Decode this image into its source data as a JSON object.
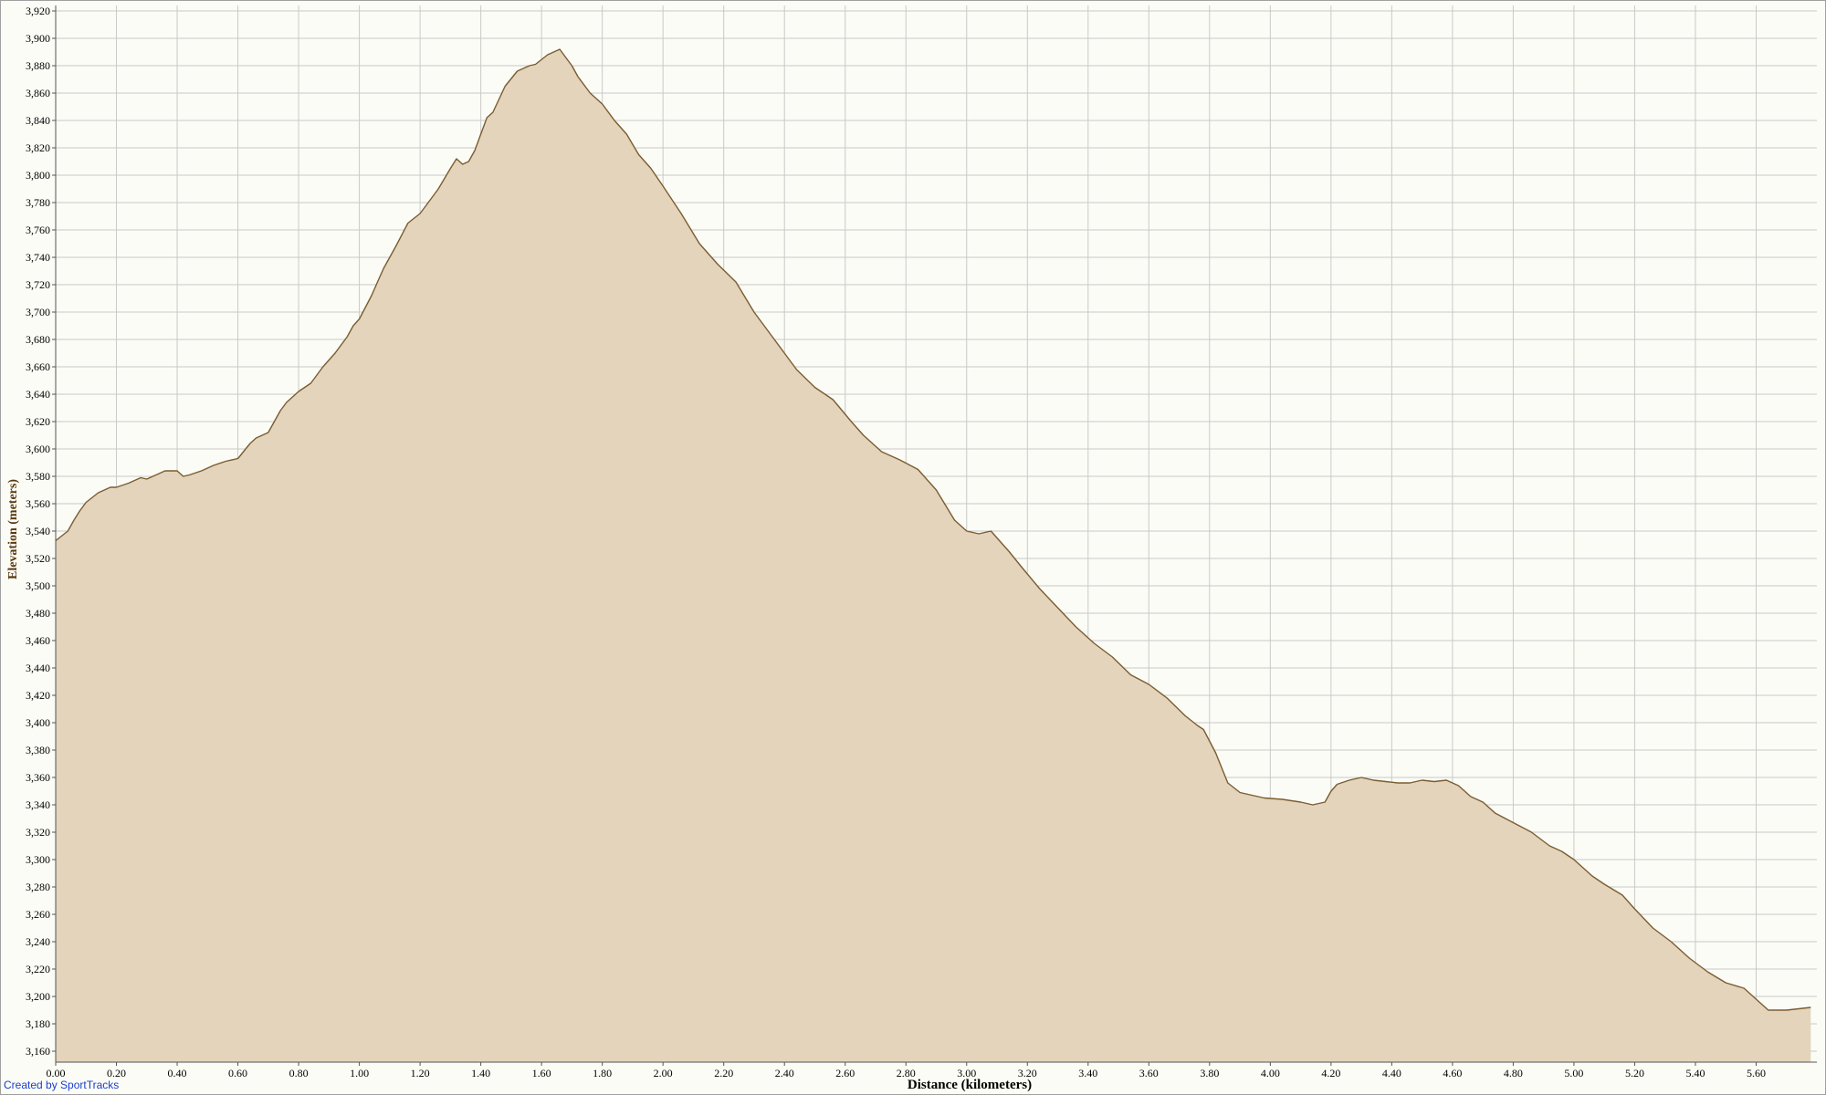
{
  "chart_data": {
    "type": "area",
    "title": "",
    "xlabel": "Distance (kilometers)",
    "ylabel": "Elevation (meters)",
    "xlim": [
      0,
      5.8
    ],
    "ylim": [
      3152,
      3924
    ],
    "x_ticks": [
      "0.00",
      "0.20",
      "0.40",
      "0.60",
      "0.80",
      "1.00",
      "1.20",
      "1.40",
      "1.60",
      "1.80",
      "2.00",
      "2.20",
      "2.40",
      "2.60",
      "2.80",
      "3.00",
      "3.20",
      "3.40",
      "3.60",
      "3.80",
      "4.00",
      "4.20",
      "4.40",
      "4.60",
      "4.80",
      "5.00",
      "5.20",
      "5.40",
      "5.60"
    ],
    "y_ticks": [
      "3,160",
      "3,180",
      "3,200",
      "3,220",
      "3,240",
      "3,260",
      "3,280",
      "3,300",
      "3,320",
      "3,340",
      "3,360",
      "3,380",
      "3,400",
      "3,420",
      "3,440",
      "3,460",
      "3,480",
      "3,500",
      "3,520",
      "3,540",
      "3,560",
      "3,580",
      "3,600",
      "3,620",
      "3,640",
      "3,660",
      "3,680",
      "3,700",
      "3,720",
      "3,740",
      "3,760",
      "3,780",
      "3,800",
      "3,820",
      "3,840",
      "3,860",
      "3,880",
      "3,900",
      "3,920"
    ],
    "grid": true,
    "legend": "none",
    "colors": {
      "fill": "#e3d4bb",
      "line": "#7a5c30",
      "grid": "#c9c9c9",
      "plot_bg": "#fcfcf6",
      "axis": "#555555"
    },
    "series": [
      {
        "x": [
          0.0,
          0.04,
          0.06,
          0.08,
          0.1,
          0.14,
          0.18,
          0.2,
          0.24,
          0.28,
          0.3,
          0.34,
          0.36,
          0.4,
          0.42,
          0.44,
          0.48,
          0.52,
          0.56,
          0.6,
          0.64,
          0.66,
          0.7,
          0.74,
          0.76,
          0.8,
          0.84,
          0.88,
          0.92,
          0.96,
          0.98,
          1.0,
          1.04,
          1.06,
          1.08,
          1.12,
          1.16,
          1.2,
          1.22,
          1.26,
          1.3,
          1.32,
          1.34,
          1.36,
          1.38,
          1.4,
          1.42,
          1.44,
          1.48,
          1.52,
          1.56,
          1.58,
          1.62,
          1.66,
          1.68,
          1.7,
          1.72,
          1.76,
          1.8,
          1.84,
          1.88,
          1.92,
          1.96,
          2.0,
          2.06,
          2.12,
          2.18,
          2.24,
          2.3,
          2.36,
          2.4,
          2.44,
          2.5,
          2.56,
          2.62,
          2.66,
          2.72,
          2.78,
          2.84,
          2.9,
          2.96,
          3.0,
          3.04,
          3.08,
          3.1,
          3.14,
          3.18,
          3.24,
          3.3,
          3.36,
          3.42,
          3.48,
          3.54,
          3.6,
          3.66,
          3.72,
          3.76,
          3.78,
          3.82,
          3.86,
          3.9,
          3.94,
          3.98,
          4.04,
          4.1,
          4.14,
          4.18,
          4.2,
          4.22,
          4.26,
          4.3,
          4.34,
          4.38,
          4.42,
          4.46,
          4.5,
          4.54,
          4.58,
          4.6,
          4.62,
          4.66,
          4.7,
          4.74,
          4.8,
          4.86,
          4.92,
          4.96,
          5.0,
          5.06,
          5.1,
          5.16,
          5.2,
          5.26,
          5.32,
          5.38,
          5.44,
          5.5,
          5.56,
          5.6,
          5.64,
          5.7,
          5.78
        ],
        "y": [
          3533,
          3540,
          3548,
          3555,
          3561,
          3568,
          3572,
          3572,
          3575,
          3579,
          3578,
          3582,
          3584,
          3584,
          3580,
          3581,
          3584,
          3588,
          3591,
          3593,
          3604,
          3608,
          3612,
          3628,
          3634,
          3642,
          3648,
          3660,
          3670,
          3682,
          3690,
          3695,
          3712,
          3722,
          3732,
          3748,
          3765,
          3772,
          3778,
          3790,
          3805,
          3812,
          3808,
          3810,
          3818,
          3830,
          3842,
          3846,
          3865,
          3876,
          3880,
          3881,
          3888,
          3892,
          3886,
          3880,
          3872,
          3860,
          3852,
          3840,
          3830,
          3815,
          3805,
          3792,
          3772,
          3750,
          3735,
          3722,
          3700,
          3682,
          3670,
          3658,
          3645,
          3636,
          3620,
          3610,
          3598,
          3592,
          3585,
          3570,
          3548,
          3540,
          3538,
          3540,
          3535,
          3525,
          3514,
          3498,
          3484,
          3470,
          3458,
          3448,
          3435,
          3428,
          3418,
          3405,
          3398,
          3395,
          3378,
          3356,
          3349,
          3347,
          3345,
          3344,
          3342,
          3340,
          3342,
          3350,
          3355,
          3358,
          3360,
          3358,
          3357,
          3356,
          3356,
          3358,
          3357,
          3358,
          3356,
          3354,
          3346,
          3342,
          3334,
          3327,
          3320,
          3310,
          3306,
          3300,
          3288,
          3282,
          3274,
          3264,
          3250,
          3240,
          3228,
          3218,
          3210,
          3206,
          3198,
          3190,
          3190,
          3192
        ]
      }
    ]
  },
  "credit": "Created by SportTracks"
}
